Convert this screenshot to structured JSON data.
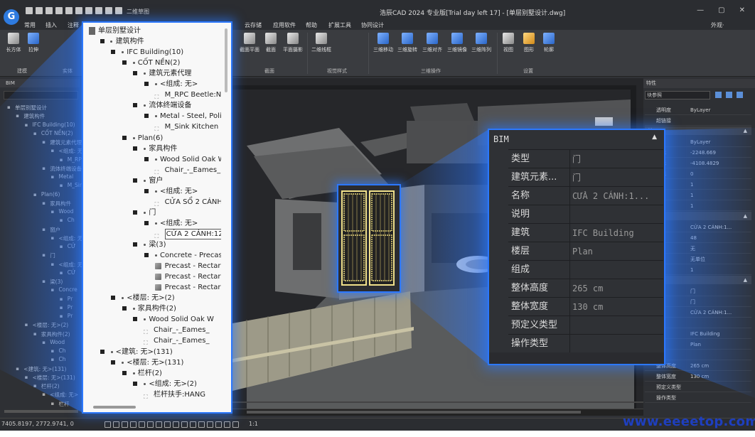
{
  "titlebar": {
    "logo": "G",
    "view_mode": "二维草图",
    "app_title": "浩辰CAD 2024 专业版[Trial day left 17] - [单层别墅设计.dwg]",
    "appearance_label": "外观·"
  },
  "menubar": {
    "items": [
      "常用",
      "插入",
      "注释",
      "云存储",
      "应用软件",
      "帮助",
      "扩展工具",
      "协同设计"
    ]
  },
  "ribbon": {
    "tools_left": [
      "长方体",
      "拉伸"
    ],
    "tools_mid": [
      "截面平面",
      "截面",
      "平面摄影",
      "二维线框"
    ],
    "tools_3d": [
      "三维移动",
      "三维旋转",
      "三维对齐",
      "三维镜像",
      "三维阵列"
    ],
    "tools_right": [
      "视图",
      "图形",
      "轮廓"
    ],
    "groups": [
      "建模",
      "实体",
      "截面",
      "视觉样式",
      "三维操作",
      "设置"
    ]
  },
  "left_panel": {
    "header": "BIM",
    "rows": [
      "单层别墅设计",
      "建筑构件",
      "IFC Building(10)",
      "CỐT NỀN(2)",
      "建筑元素代理",
      "<组成: 无>",
      "M_RPC Beetle",
      "流体终端设备",
      "Metal",
      "M_Sink",
      "Plan(6)",
      "家具构件",
      "Wood",
      "Ch",
      "窗户",
      "<组成: 无>",
      "CỬ",
      "门",
      "<组成: 无>",
      "CỬ",
      "梁(3)",
      "Concre",
      "Pr",
      "Pr",
      "Pr",
      "<楼层: 无>(2)",
      "家具构件(2)",
      "Wood",
      "Ch",
      "Ch",
      "<建筑: 无>(131)",
      "<楼层: 无>(131)",
      "栏杆(2)",
      "<组成: 无>",
      "栏杆"
    ]
  },
  "tree": {
    "items": [
      {
        "label": "单层别墅设计"
      },
      {
        "label": "建筑构件"
      },
      {
        "label": "IFC Building(10)"
      },
      {
        "label": "CỐT NỀN(2)"
      },
      {
        "label": "建筑元素代理"
      },
      {
        "label": "<组成: 无>"
      },
      {
        "label": "M_RPC Beetle:N"
      },
      {
        "label": "流体终端设备"
      },
      {
        "label": "Metal - Steel, Polis"
      },
      {
        "label": "M_Sink Kitchen"
      },
      {
        "label": "Plan(6)"
      },
      {
        "label": "家具构件"
      },
      {
        "label": "Wood Solid Oak W"
      },
      {
        "label": "Chair_-_Eames_"
      },
      {
        "label": "窗户"
      },
      {
        "label": "<组成: 无>"
      },
      {
        "label": "CỬA SỔ 2 CÁNH"
      },
      {
        "label": "门"
      },
      {
        "label": "<组成: 无>"
      },
      {
        "label": "CỬA 2 CÁNH:12"
      },
      {
        "label": "梁(3)"
      },
      {
        "label": "Concrete - Precast"
      },
      {
        "label": "Precast - Rectar"
      },
      {
        "label": "Precast - Rectar"
      },
      {
        "label": "Precast - Rectar"
      },
      {
        "label": "<楼层: 无>(2)"
      },
      {
        "label": "家具构件(2)"
      },
      {
        "label": "Wood Solid Oak W"
      },
      {
        "label": "Chair_-_Eames_"
      },
      {
        "label": "Chair_-_Eames_"
      },
      {
        "label": "<建筑: 无>(131)"
      },
      {
        "label": "<楼层: 无>(131)"
      },
      {
        "label": "栏杆(2)"
      },
      {
        "label": "<组成: 无>(2)"
      },
      {
        "label": "栏杆扶手:HANG"
      }
    ]
  },
  "popup": {
    "title": "BIM",
    "collapse": "▲",
    "rows": [
      {
        "key": "类型",
        "value": "门"
      },
      {
        "key": "建筑元素...",
        "value": "门"
      },
      {
        "key": "名称",
        "value": "CỬA 2 CÁNH:1..."
      },
      {
        "key": "说明",
        "value": ""
      },
      {
        "key": "建筑",
        "value": "IFC Building"
      },
      {
        "key": "楼层",
        "value": "Plan"
      },
      {
        "key": "组成",
        "value": ""
      },
      {
        "key": "整体高度",
        "value": "265 cm"
      },
      {
        "key": "整体宽度",
        "value": "130 cm"
      },
      {
        "key": "预定义类型",
        "value": ""
      },
      {
        "key": "操作类型",
        "value": ""
      }
    ]
  },
  "properties": {
    "header": "特性",
    "combo": "块参照",
    "rows": [
      {
        "key": "透明度",
        "value": "ByLayer"
      },
      {
        "key": "超链接",
        "value": ""
      }
    ],
    "section2_label": "其",
    "section2_rows": [
      {
        "key": "",
        "value": "ByLayer"
      },
      {
        "key": "坐标",
        "value": "-2248.669"
      },
      {
        "key": "坐标",
        "value": "-4108.4829"
      },
      {
        "key": "坐标",
        "value": "0"
      },
      {
        "key": "",
        "value": "1"
      },
      {
        "key": "",
        "value": "1"
      },
      {
        "key": "",
        "value": "1"
      }
    ],
    "section3_rows": [
      {
        "key": "",
        "value": "CỬA 2 CÁNH:1..."
      },
      {
        "key": "",
        "value": "48"
      },
      {
        "key": "",
        "value": "无"
      },
      {
        "key": "",
        "value": "无单位"
      },
      {
        "key": "",
        "value": "1"
      }
    ],
    "section4_rows": [
      {
        "key": "",
        "value": "门"
      },
      {
        "key": "",
        "value": "门"
      },
      {
        "key": "",
        "value": "CỬA 2 CÁNH:1..."
      },
      {
        "key": "",
        "value": ""
      },
      {
        "key": "",
        "value": "IFC Building"
      },
      {
        "key": "",
        "value": "Plan"
      },
      {
        "key": "",
        "value": ""
      },
      {
        "key": "整体高度",
        "value": "265 cm"
      },
      {
        "key": "整体宽度",
        "value": "130 cm"
      },
      {
        "key": "预定义类型",
        "value": ""
      },
      {
        "key": "操作类型",
        "value": ""
      }
    ]
  },
  "statusbar": {
    "coords": "7405.8197, 2772.9741, 0",
    "scale": "1:1"
  },
  "watermark": "www.eeeetop.com",
  "colors": {
    "accent": "#2c78ff",
    "panel": "#2f3135",
    "tree_bg": "#f8f8f8"
  }
}
